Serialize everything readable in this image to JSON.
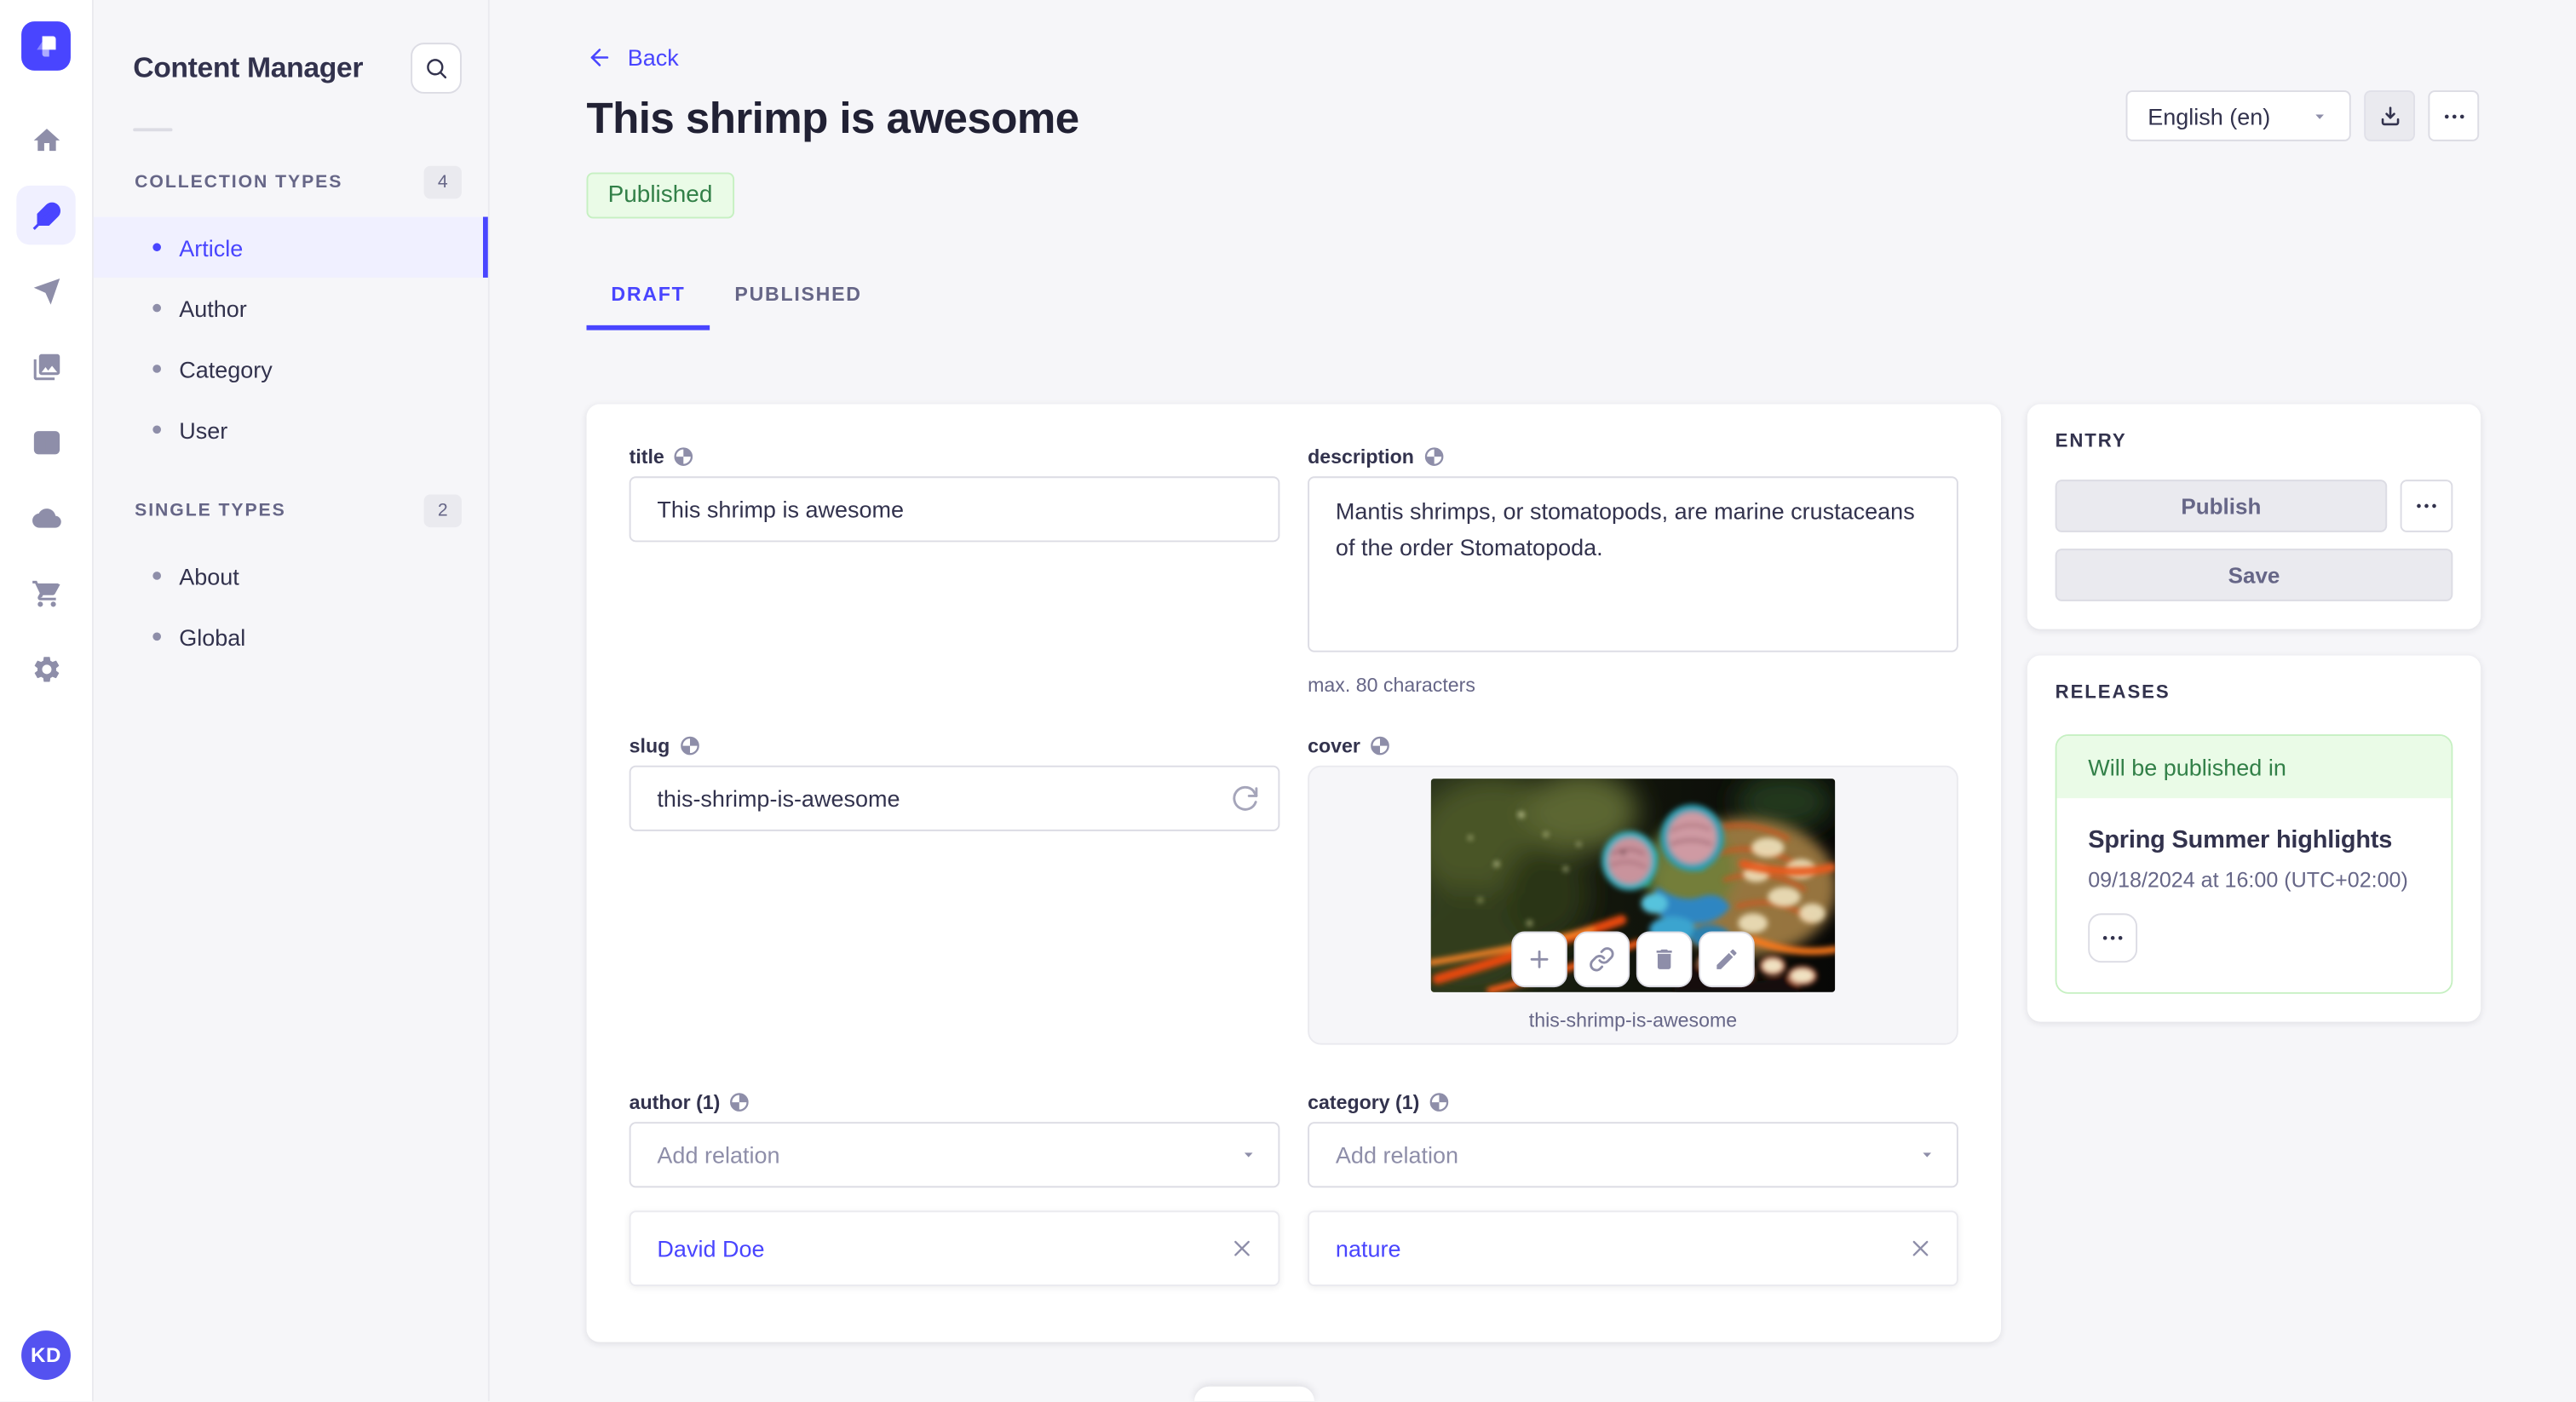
{
  "sidebar": {
    "logo_icon": "strapi-logo",
    "rail_icons": [
      "home-icon",
      "content-manager-feather-icon",
      "send-icon",
      "media-library-icon",
      "content-type-builder-icon",
      "cloud-icon",
      "marketplace-cart-icon",
      "settings-gear-icon"
    ],
    "user": {
      "initials": "KD"
    }
  },
  "subnav": {
    "title": "Content Manager",
    "search_icon": "search-icon",
    "sections": [
      {
        "label": "COLLECTION TYPES",
        "count": "4",
        "items": [
          {
            "label": "Article",
            "active": true
          },
          {
            "label": "Author",
            "active": false
          },
          {
            "label": "Category",
            "active": false
          },
          {
            "label": "User",
            "active": false
          }
        ]
      },
      {
        "label": "SINGLE TYPES",
        "count": "2",
        "items": [
          {
            "label": "About",
            "active": false
          },
          {
            "label": "Global",
            "active": false
          }
        ]
      }
    ]
  },
  "header": {
    "back_label": "Back",
    "title": "This shrimp is awesome",
    "status": "Published",
    "locale": "English (en)",
    "tabs": [
      {
        "label": "DRAFT",
        "active": true
      },
      {
        "label": "PUBLISHED",
        "active": false
      }
    ]
  },
  "form": {
    "title": {
      "label": "title",
      "value": "This shrimp is awesome"
    },
    "description": {
      "label": "description",
      "value": "Mantis shrimps, or stomatopods, are marine crustaceans of the order Stomatopoda.",
      "hint": "max. 80 characters"
    },
    "slug": {
      "label": "slug",
      "value": "this-shrimp-is-awesome"
    },
    "cover": {
      "label": "cover",
      "caption": "this-shrimp-is-awesome",
      "action_icons": [
        "plus-icon",
        "link-icon",
        "trash-icon",
        "pencil-icon"
      ]
    },
    "author": {
      "label": "author (1)",
      "placeholder": "Add relation",
      "relation": "David Doe"
    },
    "category": {
      "label": "category (1)",
      "placeholder": "Add relation",
      "relation": "nature"
    }
  },
  "entry_panel": {
    "title": "ENTRY",
    "publish_label": "Publish",
    "save_label": "Save"
  },
  "releases_panel": {
    "title": "RELEASES",
    "status": "Will be published in",
    "release_name": "Spring Summer highlights",
    "release_date": "09/18/2024 at 16:00 (UTC+02:00)"
  },
  "colors": {
    "accent": "#4945ff",
    "success_text": "#328048",
    "success_bg": "#eafbe7",
    "success_border": "#c6f0c2"
  }
}
